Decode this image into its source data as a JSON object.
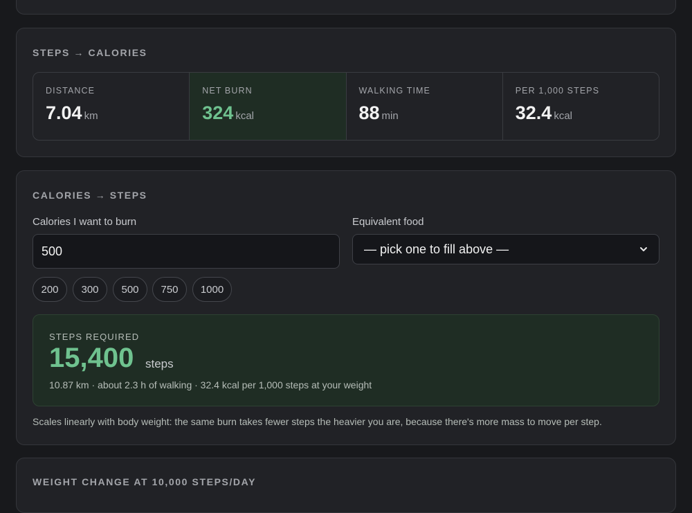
{
  "steps_to_calories": {
    "title": "STEPS → CALORIES",
    "stats": [
      {
        "label": "DISTANCE",
        "value": "7.04",
        "unit": "km"
      },
      {
        "label": "NET BURN",
        "value": "324",
        "unit": "kcal"
      },
      {
        "label": "WALKING TIME",
        "value": "88",
        "unit": "min"
      },
      {
        "label": "PER 1,000 STEPS",
        "value": "32.4",
        "unit": "kcal"
      }
    ]
  },
  "calories_to_steps": {
    "title": "CALORIES → STEPS",
    "calories_label": "Calories I want to burn",
    "calories_value": "500",
    "food_label": "Equivalent food",
    "food_selected": "— pick one to fill above —",
    "presets": [
      "200",
      "300",
      "500",
      "750",
      "1000"
    ],
    "result_label": "STEPS REQUIRED",
    "result_value": "15,400",
    "result_unit": "steps",
    "result_detail": "10.87 km · about 2.3 h of walking · 32.4 kcal per 1,000 steps at your weight",
    "note": "Scales linearly with body weight: the same burn takes fewer steps the heavier you are, because there's more mass to move per step."
  },
  "weight_change": {
    "title": "WEIGHT CHANGE AT 10,000 STEPS/DAY"
  },
  "colors": {
    "accent": "#6fc28f",
    "background": "#18191c",
    "card": "#212226"
  }
}
